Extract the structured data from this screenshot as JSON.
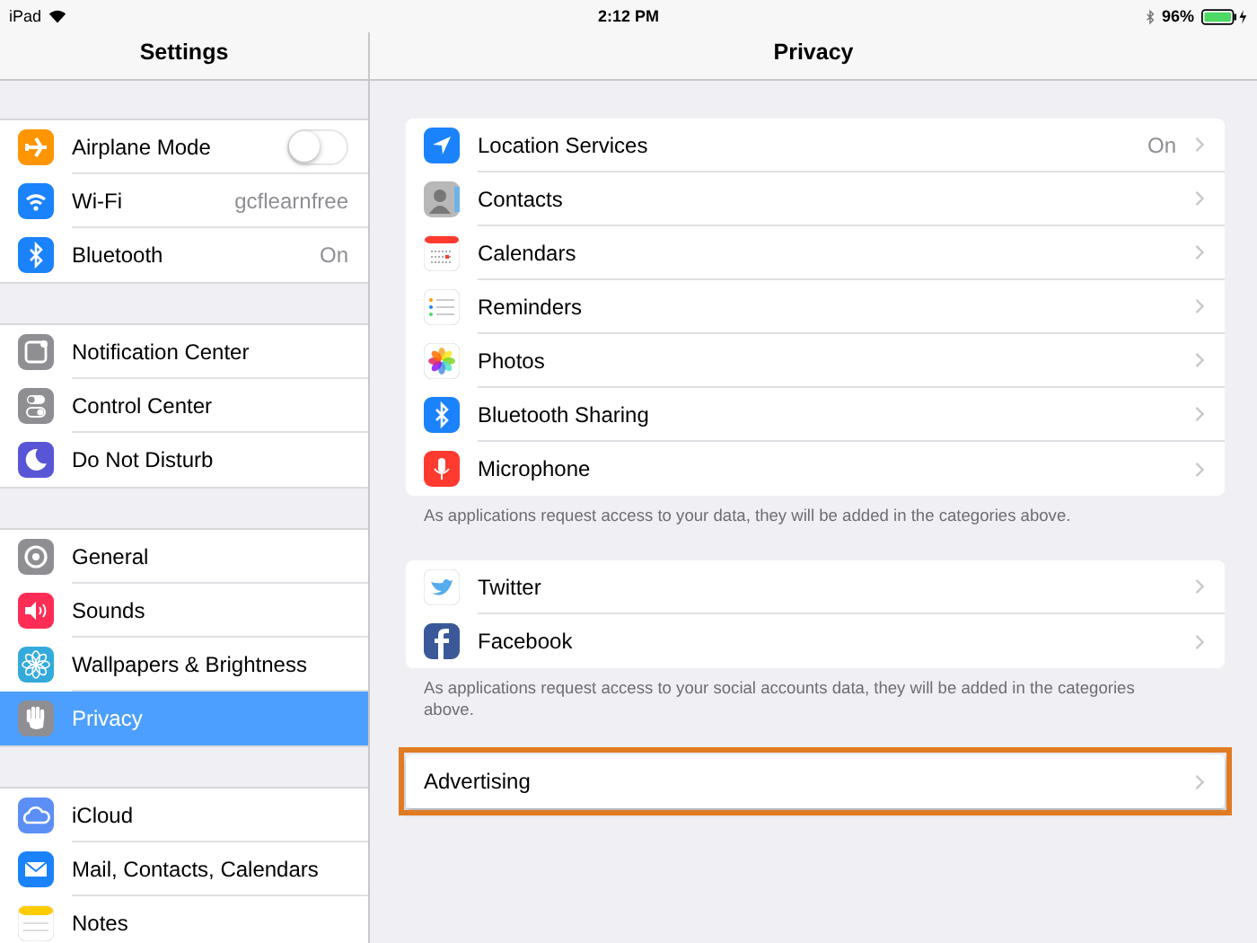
{
  "status_bar": {
    "device": "iPad",
    "time": "2:12 PM",
    "battery": "96%"
  },
  "sidebar": {
    "title": "Settings",
    "groups": [
      {
        "items": [
          {
            "label": "Airplane Mode",
            "kind": "toggle",
            "on": false,
            "selected": false
          },
          {
            "label": "Wi-Fi",
            "kind": "value",
            "value": "gcflearnfree",
            "selected": false
          },
          {
            "label": "Bluetooth",
            "kind": "value",
            "value": "On",
            "selected": false
          }
        ]
      },
      {
        "items": [
          {
            "label": "Notification Center",
            "kind": "plain",
            "selected": false
          },
          {
            "label": "Control Center",
            "kind": "plain",
            "selected": false
          },
          {
            "label": "Do Not Disturb",
            "kind": "plain",
            "selected": false
          }
        ]
      },
      {
        "items": [
          {
            "label": "General",
            "kind": "plain",
            "selected": false
          },
          {
            "label": "Sounds",
            "kind": "plain",
            "selected": false
          },
          {
            "label": "Wallpapers & Brightness",
            "kind": "plain",
            "selected": false
          },
          {
            "label": "Privacy",
            "kind": "plain",
            "selected": true
          }
        ]
      },
      {
        "items": [
          {
            "label": "iCloud",
            "kind": "plain",
            "selected": false
          },
          {
            "label": "Mail, Contacts, Calendars",
            "kind": "plain",
            "selected": false
          },
          {
            "label": "Notes",
            "kind": "plain",
            "selected": false
          }
        ]
      }
    ]
  },
  "detail": {
    "title": "Privacy",
    "groups": [
      {
        "items": [
          {
            "label": "Location Services",
            "value": "On",
            "highlighted": false
          },
          {
            "label": "Contacts",
            "highlighted": false
          },
          {
            "label": "Calendars",
            "highlighted": false
          },
          {
            "label": "Reminders",
            "highlighted": false
          },
          {
            "label": "Photos",
            "highlighted": false
          },
          {
            "label": "Bluetooth Sharing",
            "highlighted": false
          },
          {
            "label": "Microphone",
            "highlighted": false
          }
        ],
        "footer": "As applications request access to your data, they will be added in the categories above."
      },
      {
        "items": [
          {
            "label": "Twitter",
            "highlighted": false
          },
          {
            "label": "Facebook",
            "highlighted": false
          }
        ],
        "footer": "As applications request access to your social accounts data, they will be added in the categories above."
      },
      {
        "items": [
          {
            "label": "Advertising",
            "highlighted": true
          }
        ]
      }
    ]
  }
}
